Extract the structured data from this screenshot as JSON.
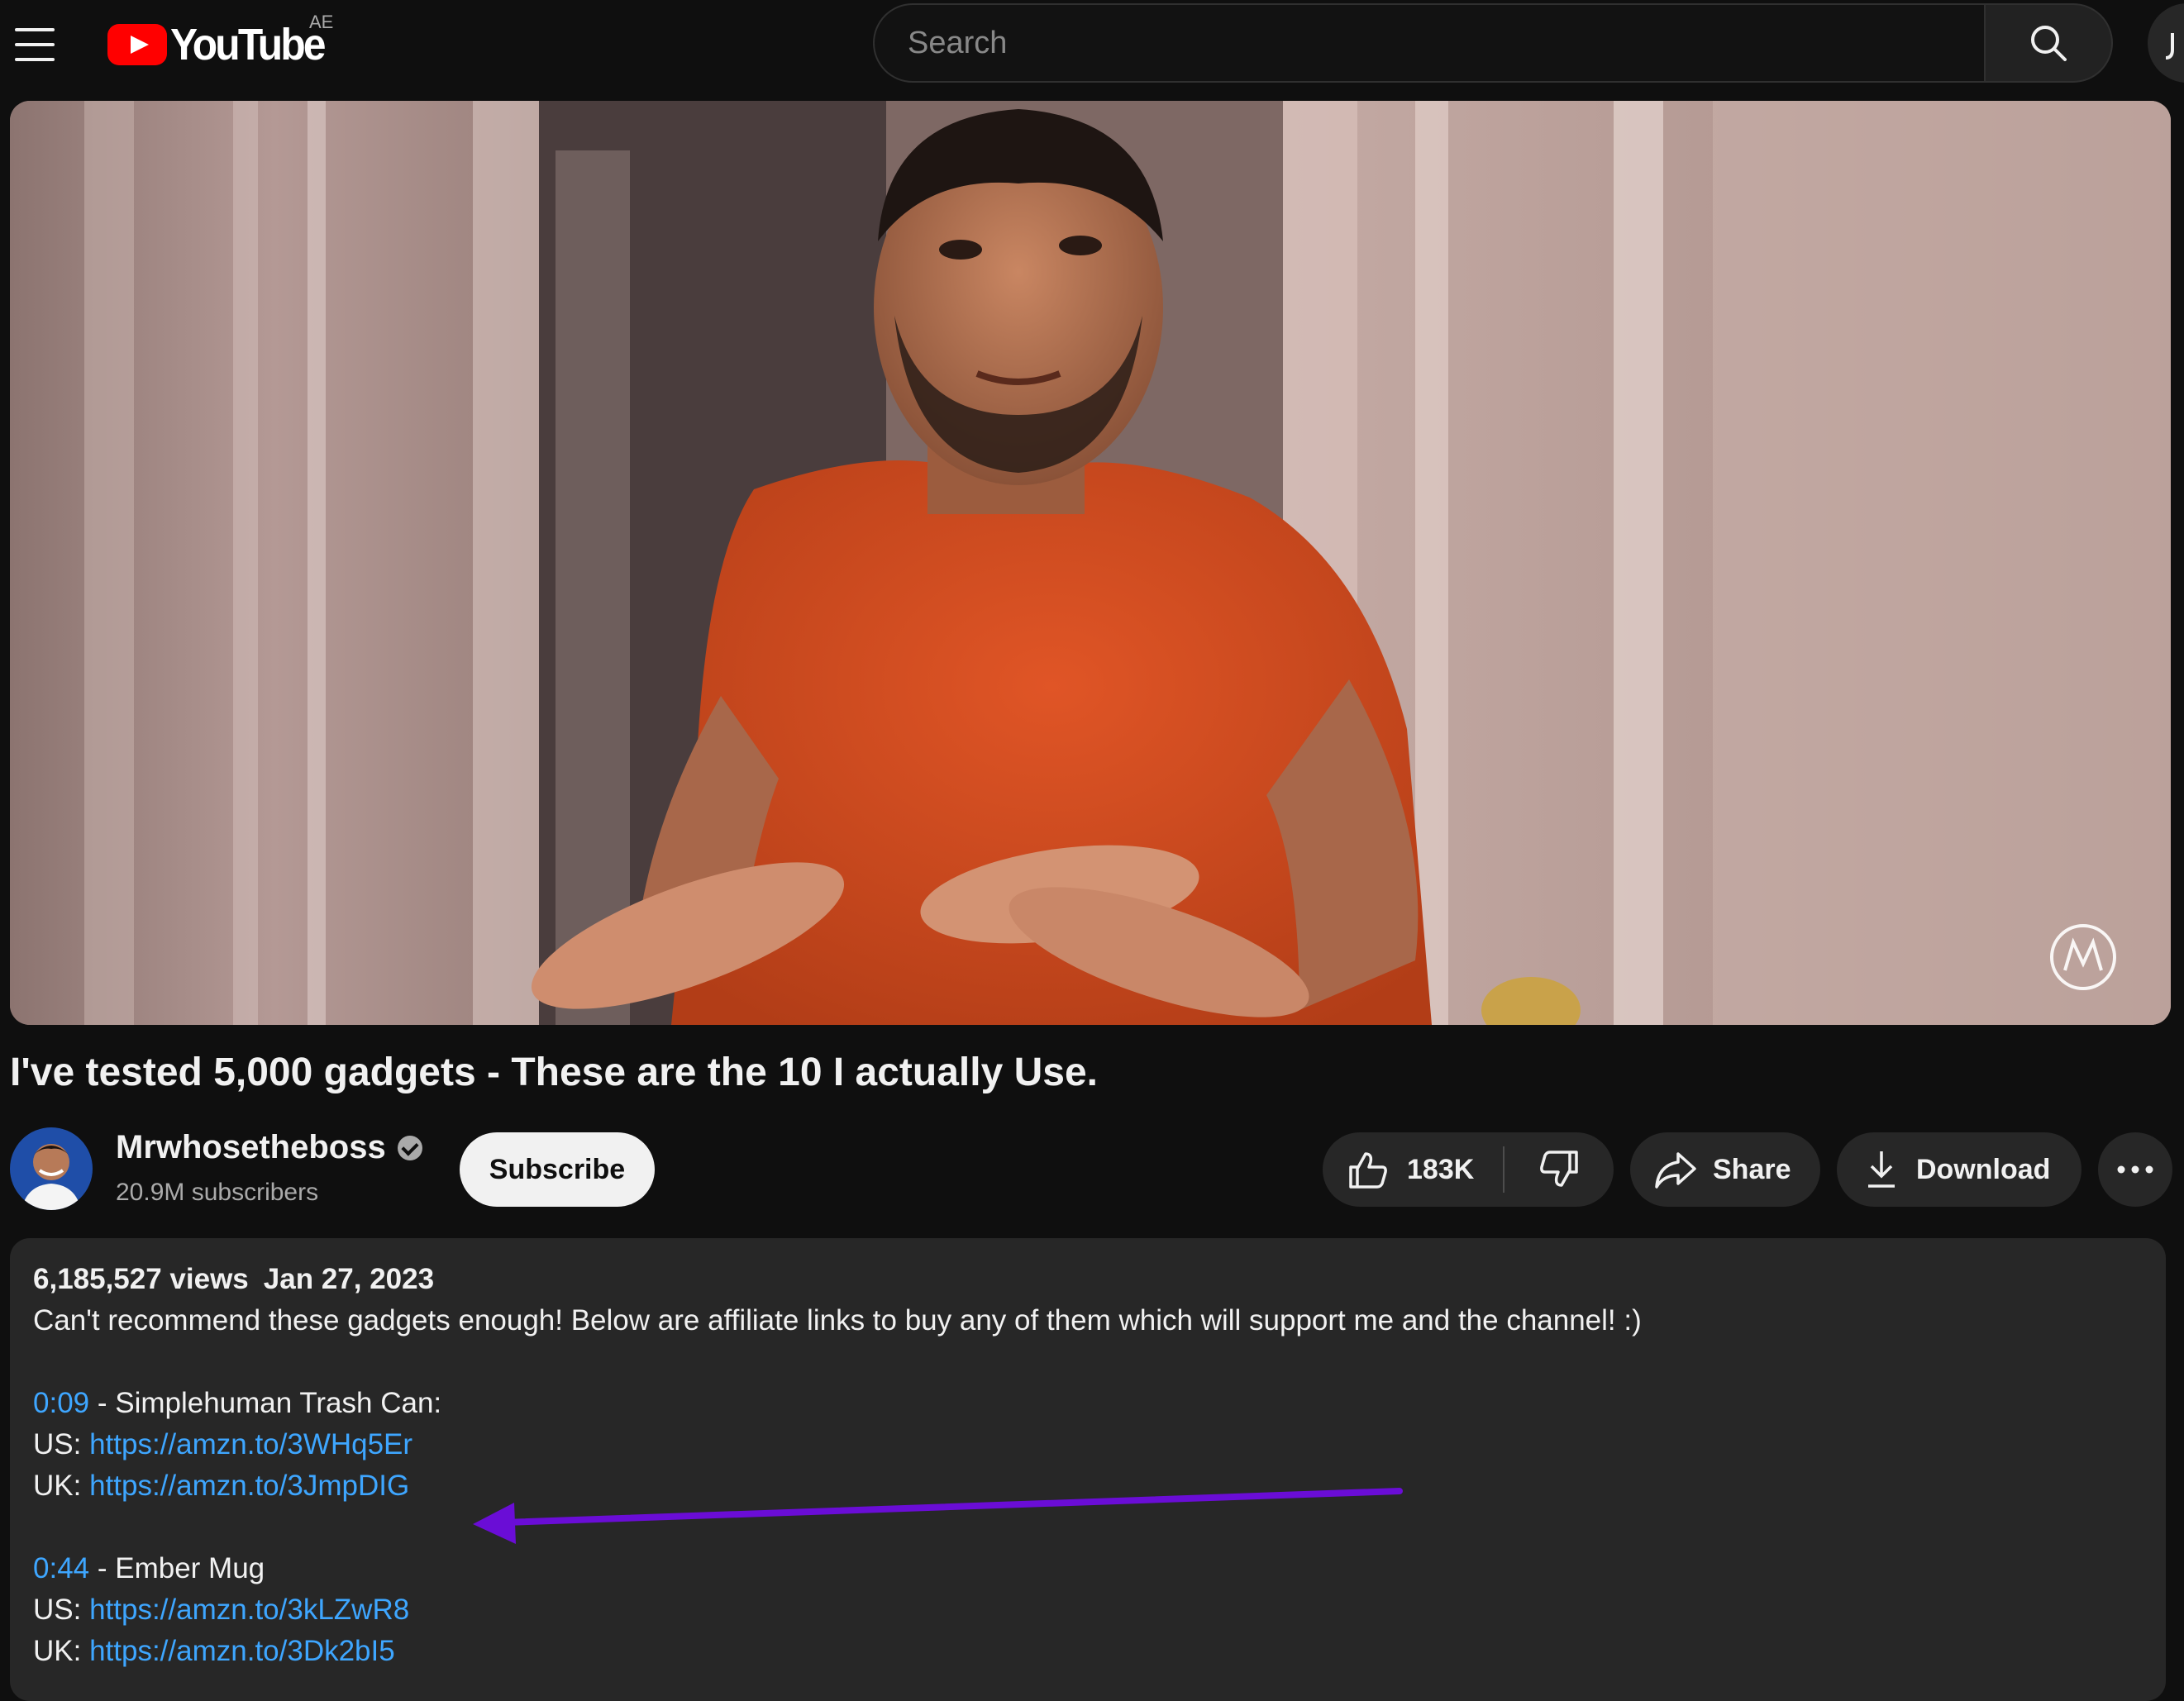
{
  "header": {
    "logo_text": "YouTube",
    "country_code": "AE",
    "search_placeholder": "Search"
  },
  "video": {
    "title": "I've tested 5,000 gadgets - These are the 10 I actually Use."
  },
  "channel": {
    "name": "Mrwhosetheboss",
    "subscribers": "20.9M subscribers",
    "subscribe_label": "Subscribe"
  },
  "actions": {
    "like_count": "183K",
    "share_label": "Share",
    "download_label": "Download"
  },
  "description": {
    "views": "6,185,527 views",
    "date": "Jan 27, 2023",
    "intro": "Can't recommend these gadgets enough! Below are affiliate links to buy any of them which will support me and the channel! :)",
    "items": [
      {
        "timestamp": "0:09",
        "name": " - Simplehuman Trash Can:",
        "us_label": "US: ",
        "us_link": "https://amzn.to/3WHq5Er",
        "uk_label": "UK: ",
        "uk_link": "https://amzn.to/3JmpDIG"
      },
      {
        "timestamp": "0:44",
        "name": " - Ember Mug",
        "us_label": "US: ",
        "us_link": "https://amzn.to/3kLZwR8",
        "uk_label": "UK: ",
        "uk_link": "https://amzn.to/3Dk2bI5"
      }
    ]
  },
  "colors": {
    "background": "#0f0f0f",
    "panel": "#272727",
    "link": "#3ea6ff",
    "brand_red": "#ff0000",
    "annotation_arrow": "#6a0dd6"
  },
  "icons": [
    "menu-icon",
    "youtube-logo-icon",
    "search-icon",
    "mic-icon",
    "like-icon",
    "dislike-icon",
    "share-icon",
    "download-icon",
    "more-icon",
    "verified-icon",
    "channel-watermark-icon"
  ]
}
